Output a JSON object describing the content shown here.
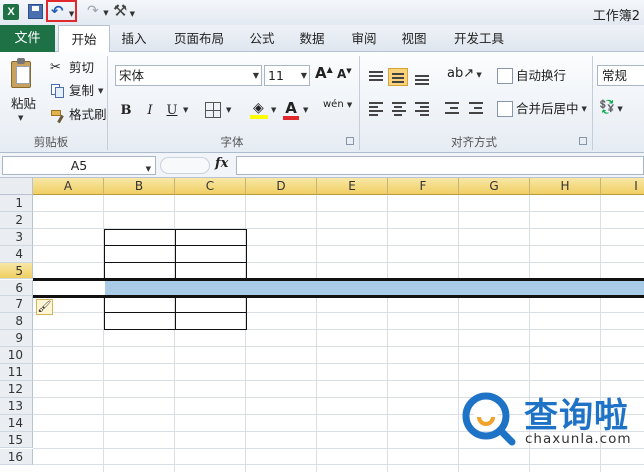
{
  "title_bar": {
    "title": "工作簿2"
  },
  "quick_access": {
    "logo_letter": "X",
    "undo_glyph": "↶",
    "redo_glyph": "↷"
  },
  "tabs": [
    {
      "label": "文件",
      "active": false
    },
    {
      "label": "开始",
      "active": true
    },
    {
      "label": "插入",
      "active": false
    },
    {
      "label": "页面布局",
      "active": false
    },
    {
      "label": "公式",
      "active": false
    },
    {
      "label": "数据",
      "active": false
    },
    {
      "label": "审阅",
      "active": false
    },
    {
      "label": "视图",
      "active": false
    },
    {
      "label": "开发工具",
      "active": false
    }
  ],
  "clipboard": {
    "paste_label": "粘贴",
    "cut_label": "剪切",
    "copy_label": "复制",
    "format_painter_label": "格式刷",
    "group_label": "剪贴板"
  },
  "font": {
    "font_name": "宋体",
    "font_size": "11",
    "bold": "B",
    "italic": "I",
    "underline": "U",
    "grow": "A",
    "shrink": "A",
    "font_color_letter": "A",
    "phonetic": "wén",
    "group_label": "字体"
  },
  "alignment": {
    "wrap_text_label": "自动换行",
    "merge_center_label": "合并后居中",
    "group_label": "对齐方式"
  },
  "number": {
    "format": "常规"
  },
  "formula_bar": {
    "name_box": "A5",
    "fx": "fx",
    "formula": ""
  },
  "sheet": {
    "columns": [
      "A",
      "B",
      "C",
      "D",
      "E",
      "F",
      "G",
      "H",
      "I"
    ],
    "rows": [
      "1",
      "2",
      "3",
      "4",
      "5",
      "6",
      "7",
      "8",
      "9",
      "10",
      "11",
      "12",
      "13",
      "14",
      "15",
      "16"
    ],
    "selected_row": "5",
    "header_color": "#f0cf63",
    "selection_color": "#aacbe8"
  },
  "watermark": {
    "brand": "查询啦",
    "url": "chaxunla.com",
    "color": "#1f73c6"
  }
}
